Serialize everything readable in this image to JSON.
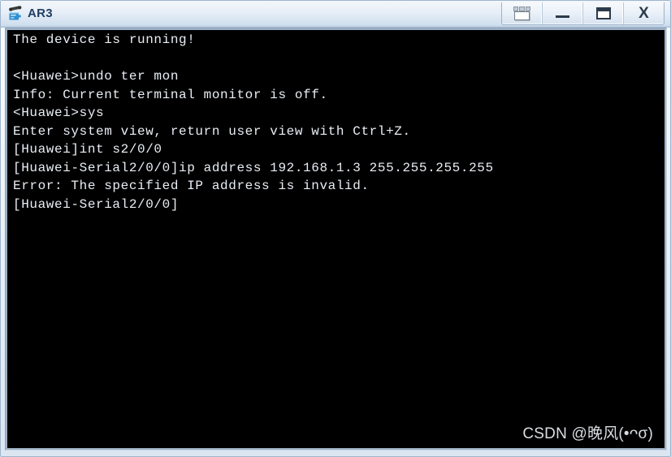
{
  "window": {
    "title": "AR3",
    "icon": "router-icon",
    "buttons": [
      {
        "name": "tile-windows-button",
        "label": "",
        "icon": "tile-windows-icon"
      },
      {
        "name": "minimize-button",
        "label": "",
        "icon": "minimize-icon"
      },
      {
        "name": "maximize-button",
        "label": "",
        "icon": "maximize-icon"
      },
      {
        "name": "close-button",
        "label": "X",
        "icon": "close-icon"
      }
    ]
  },
  "terminal": {
    "background": "#000000",
    "foreground": "#e9eef4",
    "lines": [
      "The device is running!",
      "",
      "<Huawei>undo ter mon",
      "Info: Current terminal monitor is off.",
      "<Huawei>sys",
      "Enter system view, return user view with Ctrl+Z.",
      "[Huawei]int s2/0/0",
      "[Huawei-Serial2/0/0]ip address 192.168.1.3 255.255.255.255",
      "Error: The specified IP address is invalid.",
      "[Huawei-Serial2/0/0]"
    ],
    "watermark": "CSDN @晚风(•ᴖσ)"
  }
}
